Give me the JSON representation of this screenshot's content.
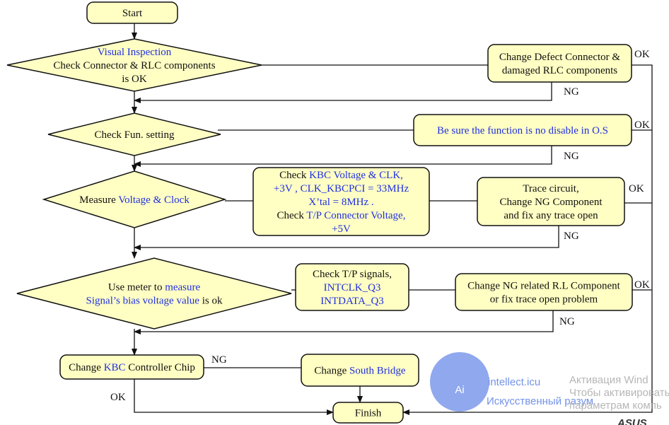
{
  "colors": {
    "text": "#111111",
    "accent_text": "#1f2fe0",
    "node_fill": "#ffffc4",
    "watermark": "#5b7fe6"
  },
  "nodes": {
    "start": [
      [
        {
          "t": "Start"
        }
      ]
    ],
    "visual": [
      [
        {
          "t": "Visual Inspection",
          "b": true
        }
      ],
      [
        {
          "t": "Check Connector & RLC components"
        }
      ],
      [
        {
          "t": "is OK"
        }
      ]
    ],
    "defect": [
      [
        {
          "t": "Change Defect Connector &"
        }
      ],
      [
        {
          "t": "damaged RLC components"
        }
      ]
    ],
    "fun": [
      [
        {
          "t": "Check Fun. setting"
        }
      ]
    ],
    "sure": [
      [
        {
          "t": "Be sure the function is no disable in O.S",
          "b": true
        }
      ]
    ],
    "measure": [
      [
        {
          "t": "Measure "
        },
        {
          "t": "Voltage & Clock",
          "b": true
        }
      ]
    ],
    "kbcv": [
      [
        {
          "t": "Check "
        },
        {
          "t": "KBC Voltage & CLK,",
          "b": true
        }
      ],
      [
        {
          "t": "+3V , CLK_KBCPCI = 33MHz",
          "b": true
        }
      ],
      [
        {
          "t": "X’tal = 8MHz .",
          "b": true
        }
      ],
      [
        {
          "t": "Check "
        },
        {
          "t": "T/P Connector Voltage,",
          "b": true
        }
      ],
      [
        {
          "t": "+5V",
          "b": true
        }
      ]
    ],
    "trace": [
      [
        {
          "t": "Trace circuit,"
        }
      ],
      [
        {
          "t": "Change NG Component"
        }
      ],
      [
        {
          "t": "and fix any trace open"
        }
      ]
    ],
    "meter": [
      [
        {
          "t": "Use meter to "
        },
        {
          "t": "measure",
          "b": true
        }
      ],
      [
        {
          "t": "Signal’s bias voltage value",
          "b": true
        },
        {
          "t": " is ok"
        }
      ]
    ],
    "tp": [
      [
        {
          "t": "Check T/P signals,"
        }
      ],
      [
        {
          "t": "INTCLK_Q3",
          "b": true
        }
      ],
      [
        {
          "t": "INTDATA_Q3",
          "b": true
        }
      ]
    ],
    "rl": [
      [
        {
          "t": "Change NG related R.L Component"
        }
      ],
      [
        {
          "t": "or fix trace open  problem"
        }
      ]
    ],
    "kbc": [
      [
        {
          "t": "Change "
        },
        {
          "t": "KBC",
          "b": true
        },
        {
          "t": " Controller Chip"
        }
      ]
    ],
    "sb": [
      [
        {
          "t": "Change "
        },
        {
          "t": "South Bridge",
          "b": true
        }
      ]
    ],
    "finish": [
      [
        {
          "t": "Finish"
        }
      ]
    ]
  },
  "edge_labels": {
    "ok1": "OK",
    "ng1": "NG",
    "ok2": "OK",
    "ng2": "NG",
    "ok3": "OK",
    "ng3": "NG",
    "ok4": "OK",
    "ng4": "NG",
    "ng5": "NG",
    "ok5": "OK"
  },
  "watermark": {
    "logo_text": "intellect.icu",
    "logo_subtext": "Искусственный разум",
    "logo_mark": "Ai"
  },
  "os_overlay": {
    "line1": "Активация Wind",
    "line2": "Чтобы активировать",
    "line3": "параметрам компь"
  },
  "brand_logo": "ASUS"
}
